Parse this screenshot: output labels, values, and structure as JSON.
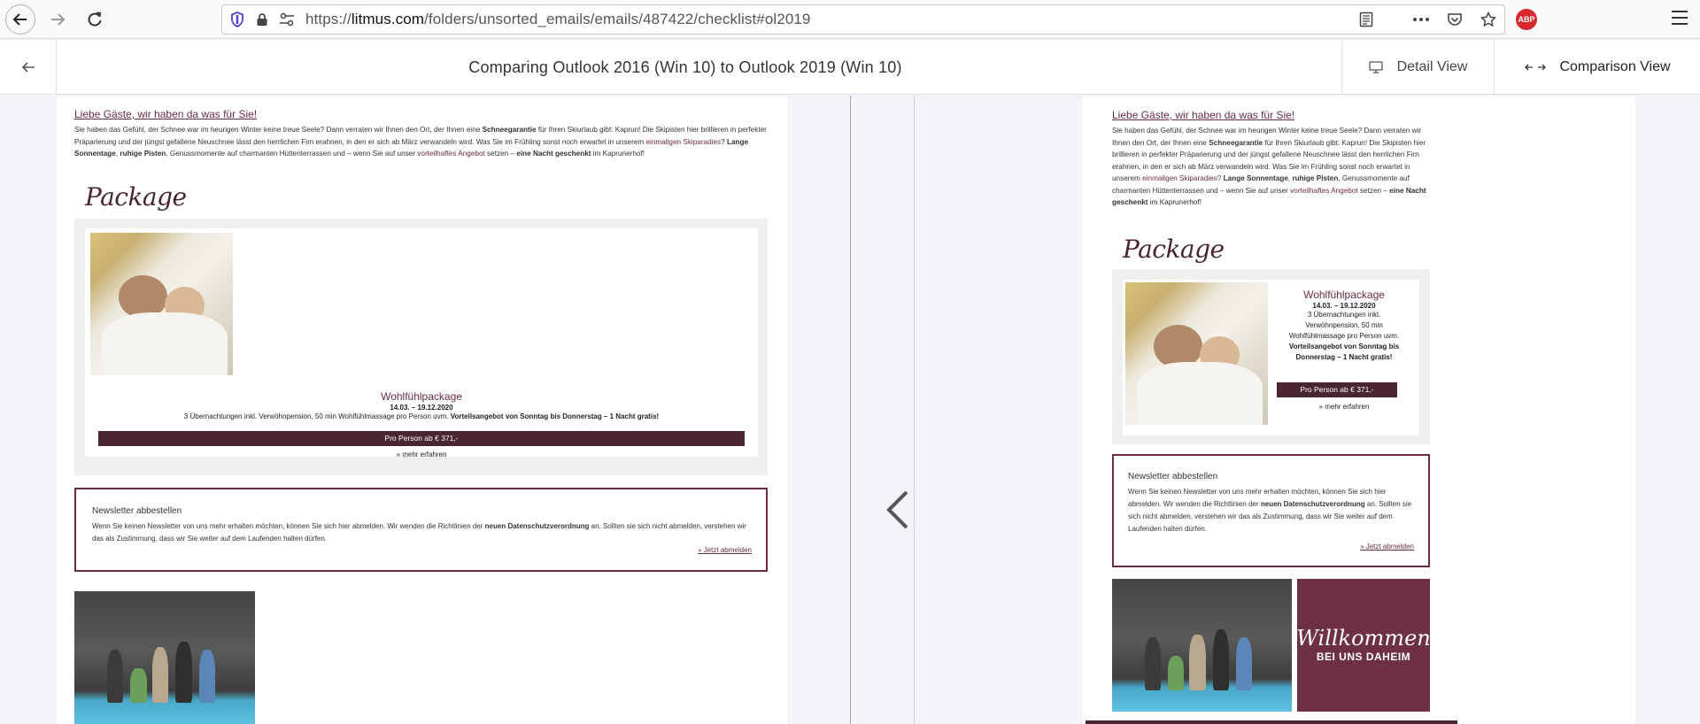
{
  "browser": {
    "url_prefix": "https://",
    "url_domain": "litmus.com",
    "url_path": "/folders/unsorted_emails/emails/487422/checklist#ol2019",
    "adblock_label": "ABP"
  },
  "header": {
    "title": "Comparing Outlook 2016 (Win 10) to Outlook 2019 (Win 10)",
    "detail_view_label": "Detail View",
    "comparison_view_label": "Comparison View"
  },
  "email": {
    "intro_title": "Liebe Gäste, wir haben da was für Sie!",
    "intro_t1": "Sie haben das Gefühl, der Schnee war im heurigen Winter keine treue Seele? Dann verraten wir Ihnen den Ort, der Ihnen eine ",
    "intro_b1": "Schneegarantie",
    "intro_t2": " für Ihren Skiurlaub gibt: Kaprun! Die Skipisten hier brillieren in perfekter Präparierung und der jüngst gefallene Neuschnee lässt den herrlichen Firn erahnen, in den er sich ab März verwandeln wird. Was Sie im Frühling sonst noch erwartet in unserem ",
    "intro_l1": "einmaligen Skiparadies",
    "intro_t3": "? ",
    "intro_b2": "Lange Sonnentage",
    "intro_t4": ", ",
    "intro_b3": "ruhige Pisten",
    "intro_t5": ", Genussmomente auf charmanten Hüttenterrassen und – wenn Sie auf unser ",
    "intro_l2": "vorteilhaftes Angebot",
    "intro_t6": " setzen – ",
    "intro_b4": "eine Nacht geschenkt",
    "intro_t7": " im Kaprunerhof!",
    "package_heading": "Package",
    "package_name": "Wohlfühlpackage",
    "package_date": "14.03. – 19.12.2020",
    "package_desc_left": "3 Übernachtungen inkl. Verwöhnpension, 50 min Wohlfühlmassage pro Person uvm.",
    "package_offer": "Vorteilsangebot von Sonntag bis Donnerstag – 1 Nacht gratis!",
    "package_desc_r1": "3 Übernachtungen inkl.",
    "package_desc_r2": "Verwöhnpension, 50 min",
    "package_desc_r3": "Wohlfühlmassage pro Person uvm.",
    "package_offer_r1": "Vorteilsangebot von Sonntag bis",
    "package_offer_r2": "Donnerstag – 1 Nacht gratis!",
    "price": "Pro Person ab € 371,-",
    "more_link": "» mehr erfahren",
    "newsletter_title": "Newsletter abbestellen",
    "newsletter_t1": "Wenn Sie keinen Newsletter von uns mehr erhalten möchten, können Sie sich hier abmelden. Wir wenden die Richtlinien der ",
    "newsletter_b1": "neuen Datenschutzverordnung",
    "newsletter_t2": " an. Sollten sie sich nicht abmelden, verstehen wir das als Zustimmung, dass wir Sie weiter auf dem Laufenden halten dürfen.",
    "unsubscribe_link": "» Jetzt abmelden",
    "welcome_script": "Willkommen",
    "welcome_sub": "BEI UNS DAHEIM"
  }
}
